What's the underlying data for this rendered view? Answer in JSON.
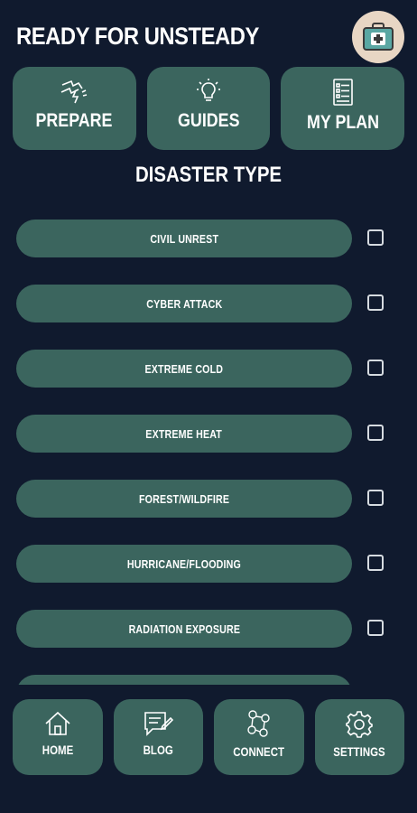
{
  "app": {
    "title": "READY FOR UNSTEADY"
  },
  "top_nav": [
    {
      "label": "PREPARE",
      "icon": "storm-icon"
    },
    {
      "label": "GUIDES",
      "icon": "lightbulb-icon"
    },
    {
      "label": "MY PLAN",
      "icon": "checklist-icon"
    }
  ],
  "section": {
    "title": "DISASTER TYPE"
  },
  "disasters": [
    {
      "label": "CIVIL UNREST",
      "checked": false
    },
    {
      "label": "CYBER ATTACK",
      "checked": false
    },
    {
      "label": "EXTREME COLD",
      "checked": false
    },
    {
      "label": "EXTREME HEAT",
      "checked": false
    },
    {
      "label": "FOREST/WILDFIRE",
      "checked": false
    },
    {
      "label": "HURRICANE/FLOODING",
      "checked": false
    },
    {
      "label": "RADIATION EXPOSURE",
      "checked": false
    },
    {
      "label": "",
      "checked": false
    }
  ],
  "bottom_nav": [
    {
      "label": "HOME",
      "icon": "home-icon"
    },
    {
      "label": "BLOG",
      "icon": "blog-icon"
    },
    {
      "label": "CONNECT",
      "icon": "connect-icon"
    },
    {
      "label": "SETTINGS",
      "icon": "gear-icon"
    }
  ],
  "colors": {
    "background": "#101a2e",
    "card": "#3b655e",
    "kit_button_bg": "#e8d6c4",
    "kit_icon": "#5aa7a3"
  }
}
